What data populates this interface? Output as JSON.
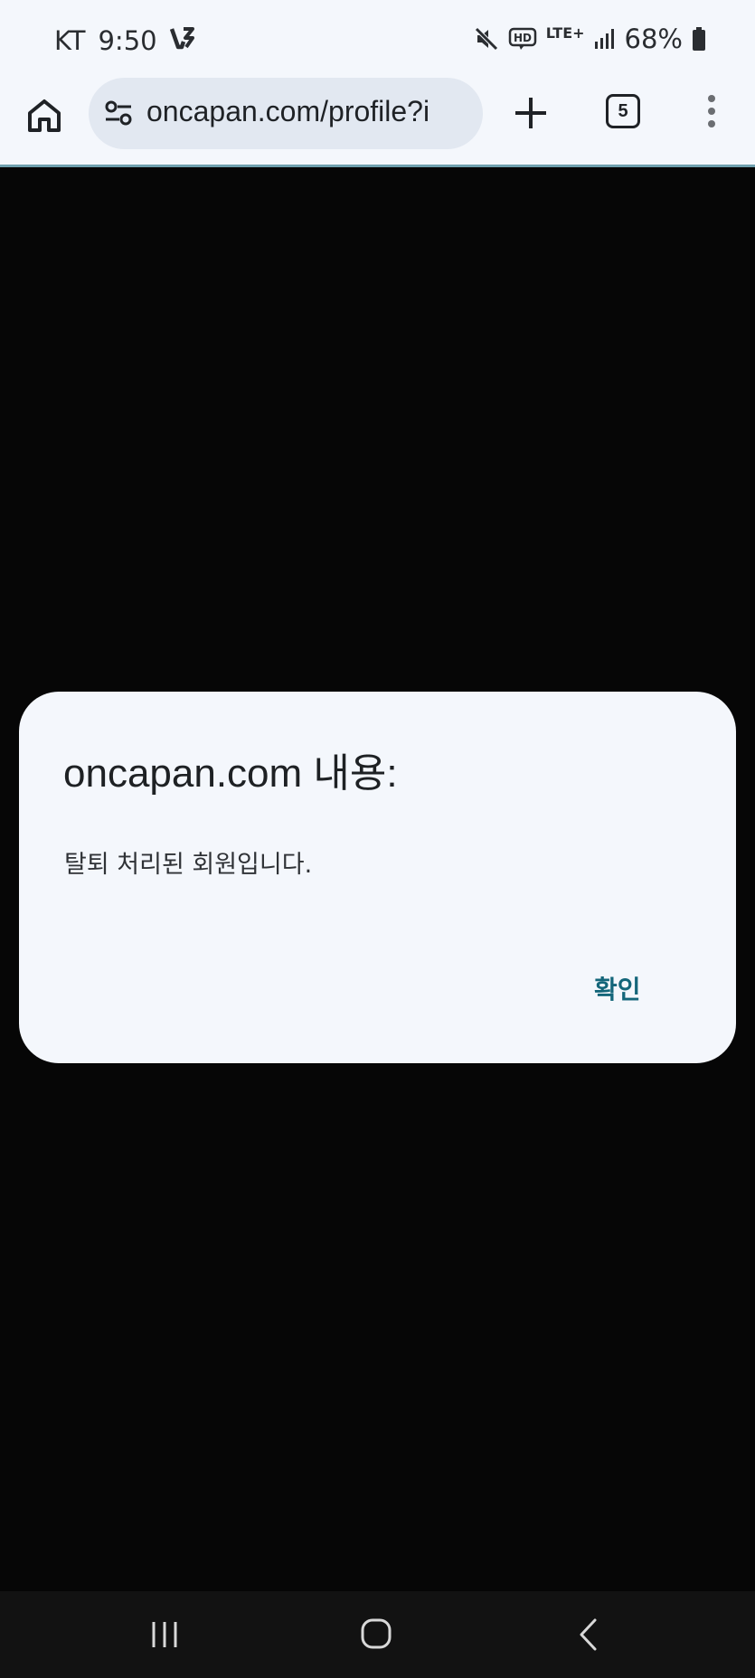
{
  "status_bar": {
    "carrier": "KT",
    "time": "9:50",
    "network": "LTE+",
    "hd_label": "HD",
    "battery": "68%",
    "icons": [
      "app-notification-icon",
      "mute-icon",
      "hd-voice-icon",
      "signal-icon",
      "battery-icon"
    ]
  },
  "browser": {
    "url": "oncapan.com/profile?i",
    "tab_count": "5",
    "icons": [
      "home-icon",
      "site-settings-icon",
      "plus-icon",
      "tabs-icon",
      "more-vert-icon"
    ]
  },
  "dialog": {
    "title": "oncapan.com 내용:",
    "message": "탈퇴 처리된 회원입니다.",
    "ok_label": "확인"
  },
  "nav_bar": {
    "icons": [
      "recent-apps-icon",
      "home-button-icon",
      "back-icon"
    ]
  },
  "colors": {
    "background": "#060606",
    "surface": "#f4f7fc",
    "url_bar": "#e2e8f1",
    "accent": "#14667a",
    "nav_bar": "#121212"
  }
}
